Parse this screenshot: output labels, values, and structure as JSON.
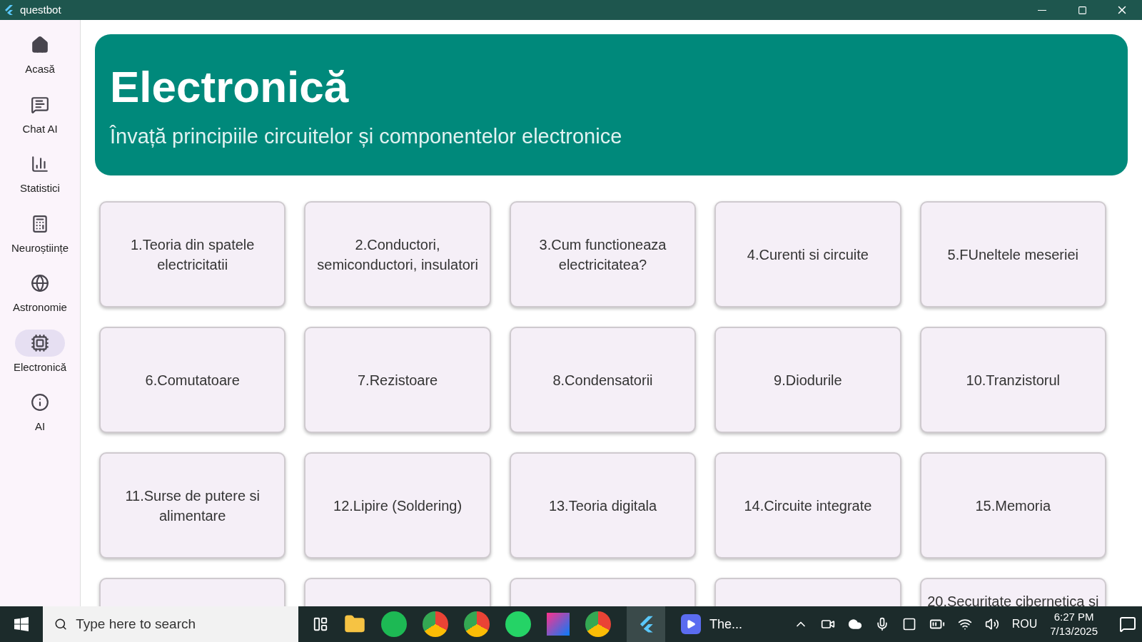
{
  "window": {
    "title": "questbot"
  },
  "sidebar": {
    "items": [
      {
        "label": "Acasă",
        "selected": false
      },
      {
        "label": "Chat AI",
        "selected": false
      },
      {
        "label": "Statistici",
        "selected": false
      },
      {
        "label": "Neuroștiințe",
        "selected": false
      },
      {
        "label": "Astronomie",
        "selected": false
      },
      {
        "label": "Electronică",
        "selected": true
      },
      {
        "label": "AI",
        "selected": false
      }
    ]
  },
  "header": {
    "title": "Electronică",
    "subtitle": "Învață principiile circuitelor și componentelor electronice"
  },
  "lessons": [
    {
      "kind": "full",
      "label": "1.Teoria din spatele electricitatii"
    },
    {
      "kind": "full",
      "label": "2.Conductori, semiconductori, insulatori"
    },
    {
      "kind": "full",
      "label": "3.Cum functioneaza electricitatea?"
    },
    {
      "kind": "full",
      "label": "4.Curenti si circuite"
    },
    {
      "kind": "full",
      "label": "5.FUneltele meseriei"
    },
    {
      "kind": "full",
      "label": "6.Comutatoare"
    },
    {
      "kind": "full",
      "label": "7.Rezistoare"
    },
    {
      "kind": "full",
      "label": "8.Condensatorii"
    },
    {
      "kind": "full",
      "label": "9.Diodurile"
    },
    {
      "kind": "full",
      "label": "10.Tranzistorul"
    },
    {
      "kind": "full",
      "label": "11.Surse de putere si alimentare"
    },
    {
      "kind": "full",
      "label": "12.Lipire (Soldering)"
    },
    {
      "kind": "full",
      "label": "13.Teoria digitala"
    },
    {
      "kind": "full",
      "label": "14.Circuite integrate"
    },
    {
      "kind": "full",
      "label": "15.Memoria"
    },
    {
      "kind": "cut"
    },
    {
      "kind": "cut"
    },
    {
      "kind": "cut"
    },
    {
      "kind": "cut"
    },
    {
      "kind": "cut",
      "label": "20.Securitate cibernetica si"
    }
  ],
  "taskbar": {
    "search": {
      "placeholder": "Type here to search"
    },
    "running_app": "The...",
    "language": "ROU",
    "time": "6:27 PM",
    "date": "7/13/2025"
  }
}
